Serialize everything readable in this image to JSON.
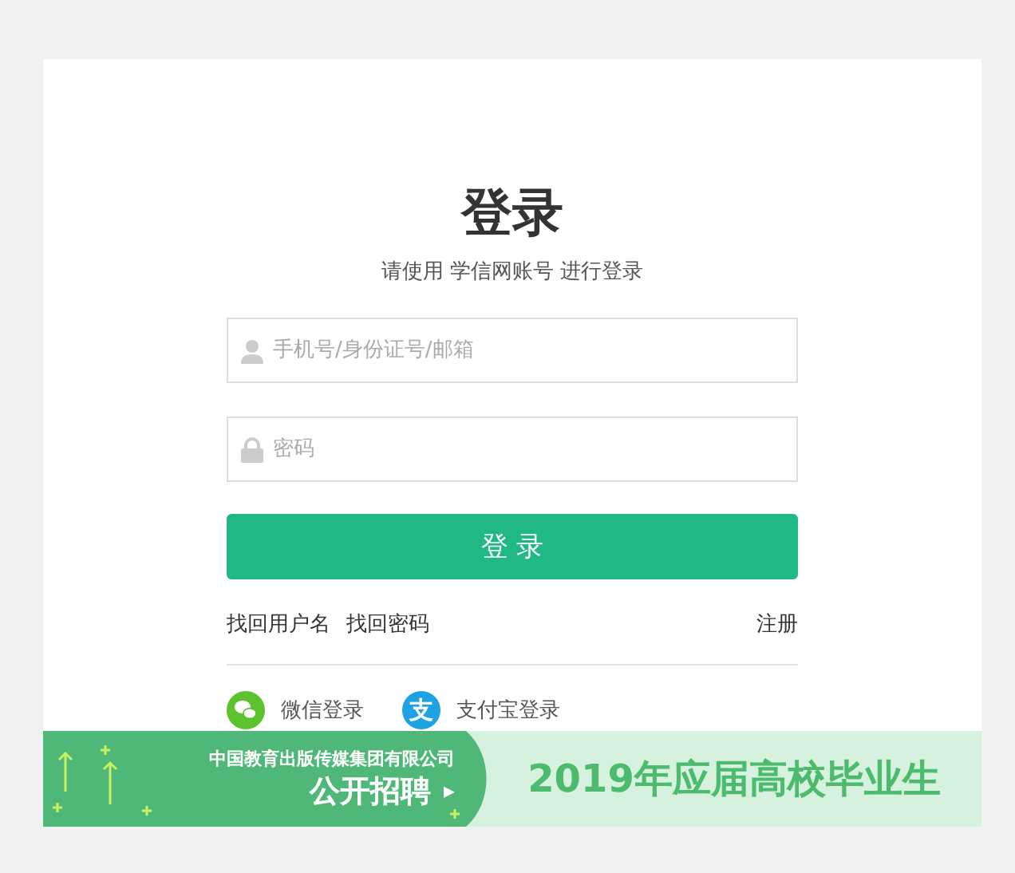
{
  "login": {
    "title": "登录",
    "subtitle": "请使用 学信网账号 进行登录",
    "fields": [
      {
        "kind": "user",
        "placeholder": "手机号/身份证号/邮箱"
      },
      {
        "kind": "password",
        "placeholder": "密码"
      }
    ],
    "submit": "登 录",
    "links": [
      {
        "label": "找回用户名"
      },
      {
        "label": "找回密码"
      }
    ],
    "register": "注册",
    "social": [
      {
        "kind": "wechat",
        "label": "微信登录"
      },
      {
        "kind": "alipay",
        "label": "支付宝登录",
        "icon_text": "支"
      }
    ]
  },
  "banner": {
    "company": "中国教育出版传媒集团有限公司",
    "action": "公开招聘",
    "arrow": "▸",
    "headline": "2019年应届高校毕业生"
  }
}
